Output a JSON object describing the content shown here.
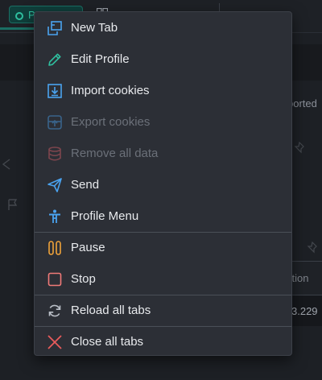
{
  "background": {
    "profile_chip_label": "Pr...",
    "grid_tab_label": "",
    "right_text_1": "ported",
    "right_text_2": "ction",
    "right_text_3": "3.229"
  },
  "context_menu": {
    "items": [
      {
        "label": "New Tab",
        "icon": "new-tab-icon",
        "enabled": true
      },
      {
        "label": "Edit Profile",
        "icon": "pencil-icon",
        "enabled": true
      },
      {
        "label": "Import cookies",
        "icon": "import-icon",
        "enabled": true
      },
      {
        "label": "Export cookies",
        "icon": "export-icon",
        "enabled": false
      },
      {
        "label": "Remove all data",
        "icon": "database-icon",
        "enabled": false
      },
      {
        "label": "Send",
        "icon": "send-icon",
        "enabled": true
      },
      {
        "label": "Profile Menu",
        "icon": "person-icon",
        "enabled": true
      },
      {
        "label": "Pause",
        "icon": "pause-icon",
        "enabled": true
      },
      {
        "label": "Stop",
        "icon": "stop-icon",
        "enabled": true
      },
      {
        "label": "Reload all tabs",
        "icon": "reload-icon",
        "enabled": true
      },
      {
        "label": "Close all tabs",
        "icon": "close-icon",
        "enabled": true
      }
    ]
  },
  "colors": {
    "accent_blue": "#4aa3f0",
    "accent_green": "#2fbf9f",
    "pause_orange": "#f0a33a",
    "stop_red": "#f07a78",
    "close_red": "#e85b5b"
  }
}
